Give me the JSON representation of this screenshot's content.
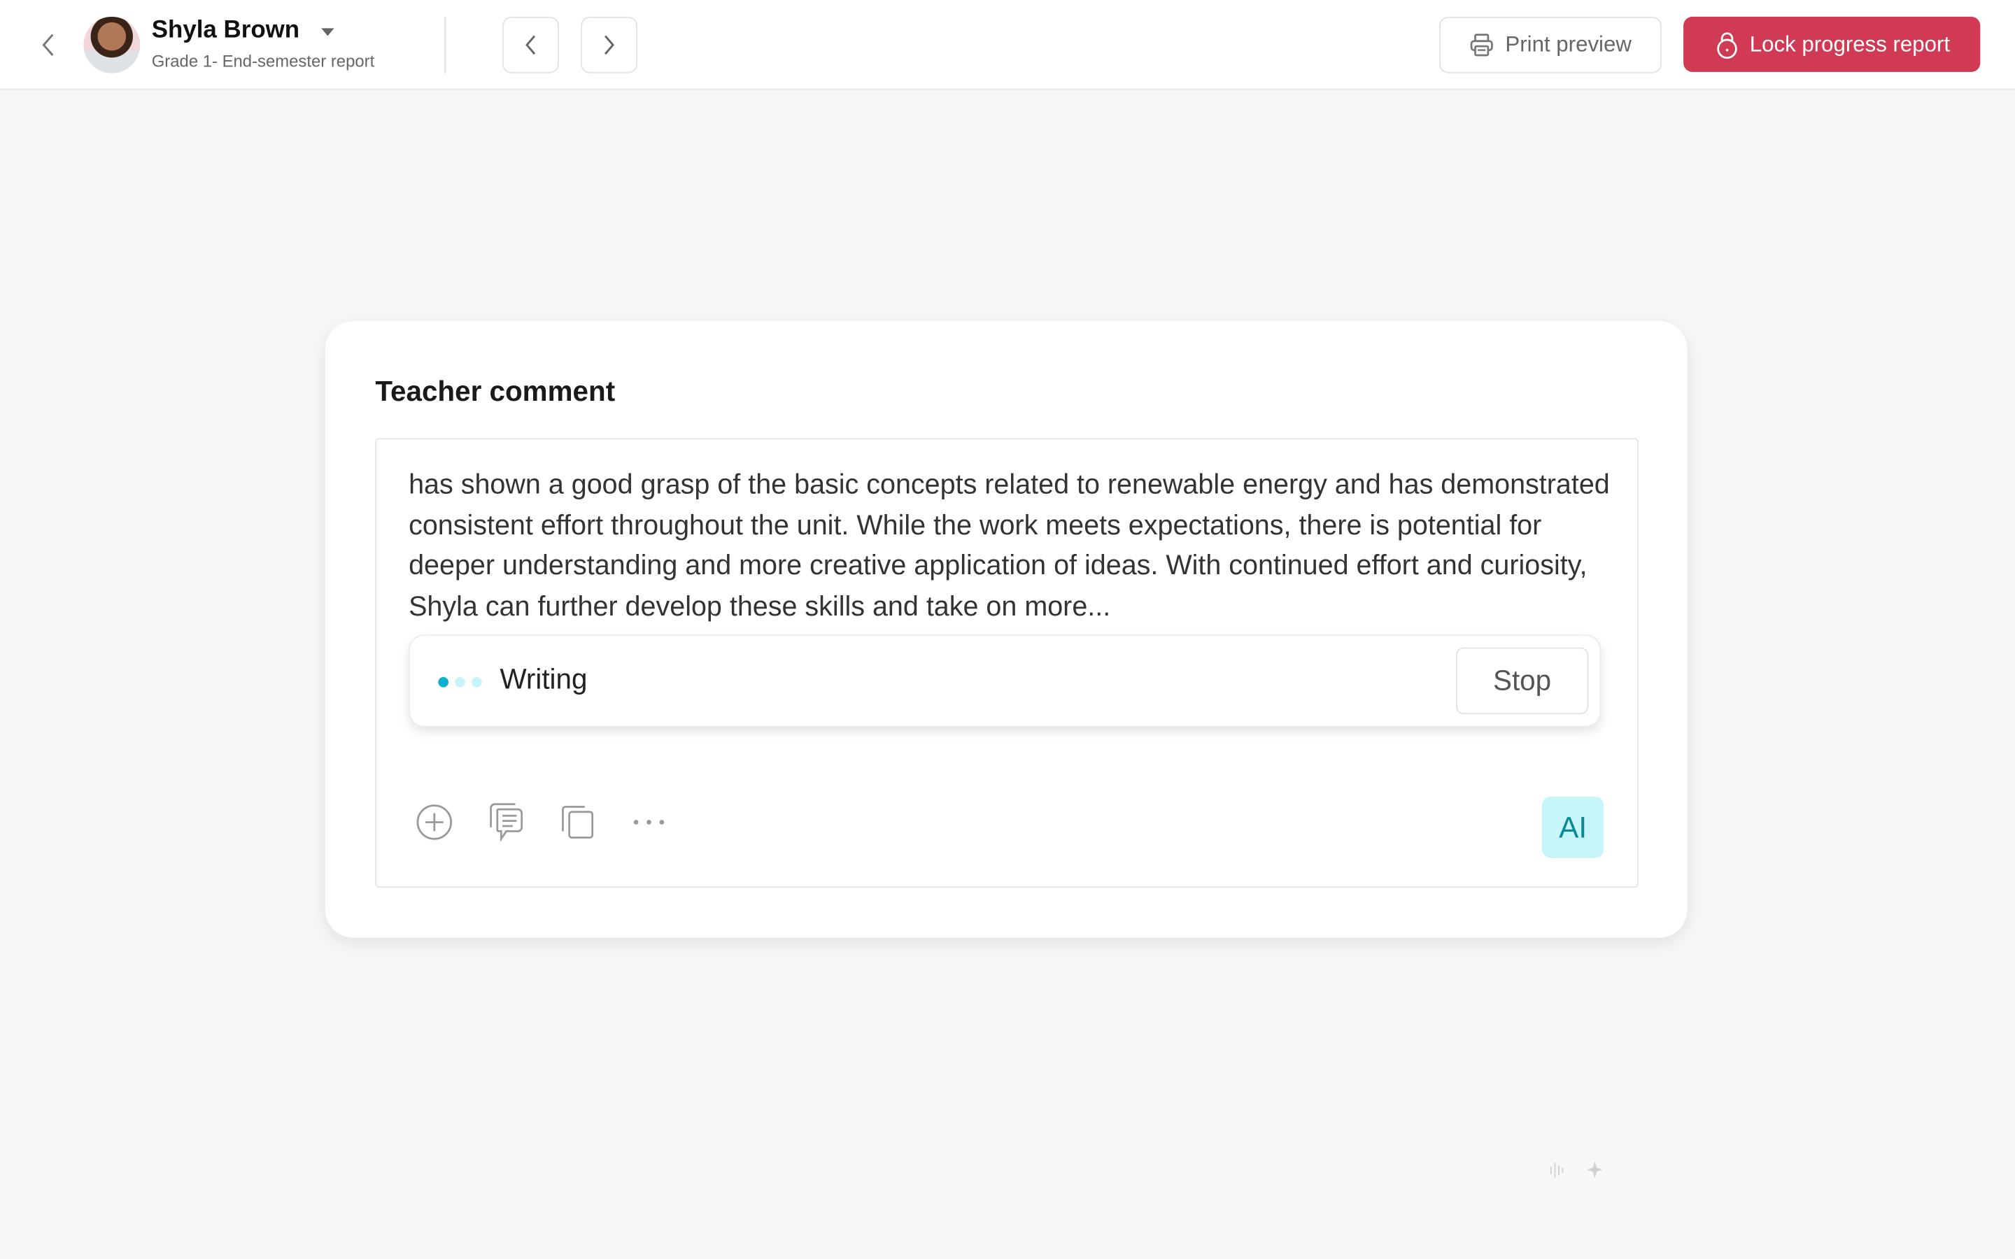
{
  "header": {
    "student_name": "Shyla Brown",
    "subtitle": "Grade 1- End-semester report",
    "print_label": "Print preview",
    "lock_label": "Lock progress report"
  },
  "card": {
    "title": "Teacher comment",
    "comment_text": "has shown a good grasp of the basic concepts related to renewable energy and has demonstrated consistent effort throughout the unit. While the work meets expectations, there is potential for deeper understanding and more creative application of ideas. With continued effort and curiosity, Shyla can further develop these skills and take on more...",
    "writing_status": "Writing",
    "stop_label": "Stop",
    "ai_label": "AI"
  },
  "colors": {
    "accent": "#d13a54",
    "ai_bg": "#c6f6fa",
    "ai_text": "#0b8895",
    "dot_active": "#0fb2cc"
  }
}
